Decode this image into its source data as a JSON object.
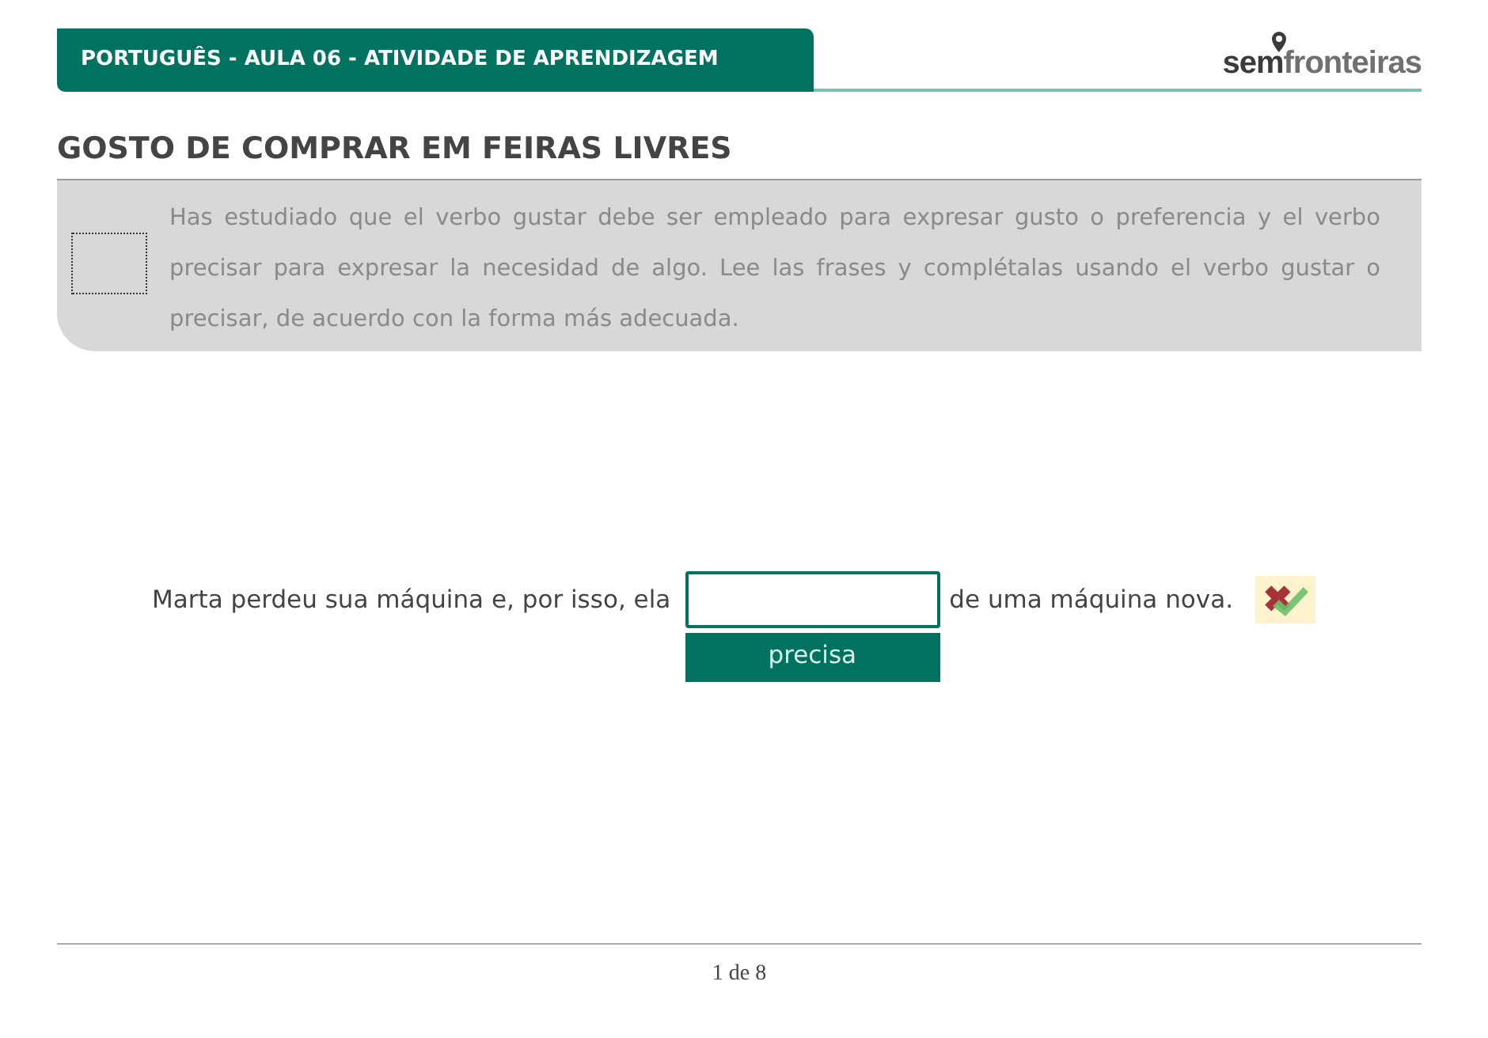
{
  "header": {
    "title": "PORTUGUÊS - AULA 06 - ATIVIDADE DE APRENDIZAGEM",
    "logo": {
      "prefix": "sem",
      "suffix": "fronteiras"
    }
  },
  "activity_title": "GOSTO DE COMPRAR EM FEIRAS LIVRES",
  "instructions": "Has estudiado que el verbo gustar debe ser empleado para expresar gusto o preferencia y el verbo precisar para expresar la necesidad de algo. Lee las frases y complétalas usando el verbo gustar o precisar, de acuerdo con la forma más adecuada.",
  "exercise": {
    "before": "Marta perdeu sua máquina e, por isso, ela",
    "after": "de uma máquina nova.",
    "option": "precisa"
  },
  "pager": "1 de 8"
}
